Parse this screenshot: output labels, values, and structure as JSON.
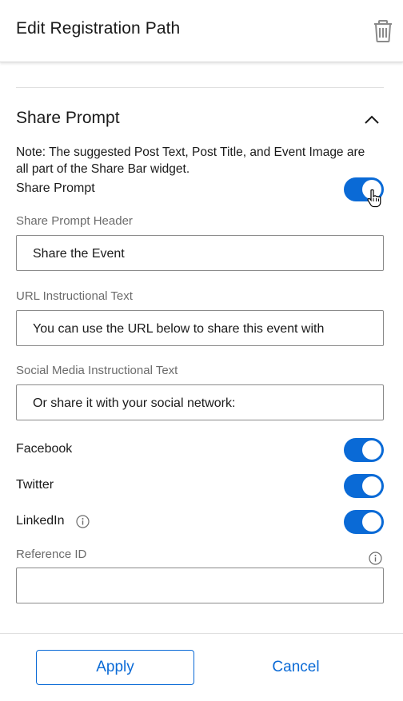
{
  "header": {
    "title": "Edit Registration Path",
    "delete_icon": "trash-icon"
  },
  "section": {
    "title": "Share Prompt",
    "collapse_icon": "chevron-up-icon",
    "note": "Note: The suggested Post Text, Post Title, and Event Image are all part of the Share Bar widget."
  },
  "share_prompt_toggle": {
    "label": "Share Prompt",
    "on": true
  },
  "fields": {
    "header": {
      "label": "Share Prompt Header",
      "value": "Share the Event"
    },
    "url_text": {
      "label": "URL Instructional Text",
      "value": "You can use the URL below to share this event with"
    },
    "social_text": {
      "label": "Social Media Instructional Text",
      "value": "Or share it with your social network:"
    },
    "reference_id": {
      "label": "Reference ID",
      "value": ""
    }
  },
  "social": {
    "facebook": {
      "label": "Facebook",
      "on": true
    },
    "twitter": {
      "label": "Twitter",
      "on": true
    },
    "linkedin": {
      "label": "LinkedIn",
      "on": true,
      "info_icon": "info-icon"
    }
  },
  "footer": {
    "apply_label": "Apply",
    "cancel_label": "Cancel"
  },
  "colors": {
    "accent": "#0a6ad6",
    "text": "#1a1a1a",
    "muted_label": "#6b6b6b",
    "border": "#8a8a8a"
  }
}
